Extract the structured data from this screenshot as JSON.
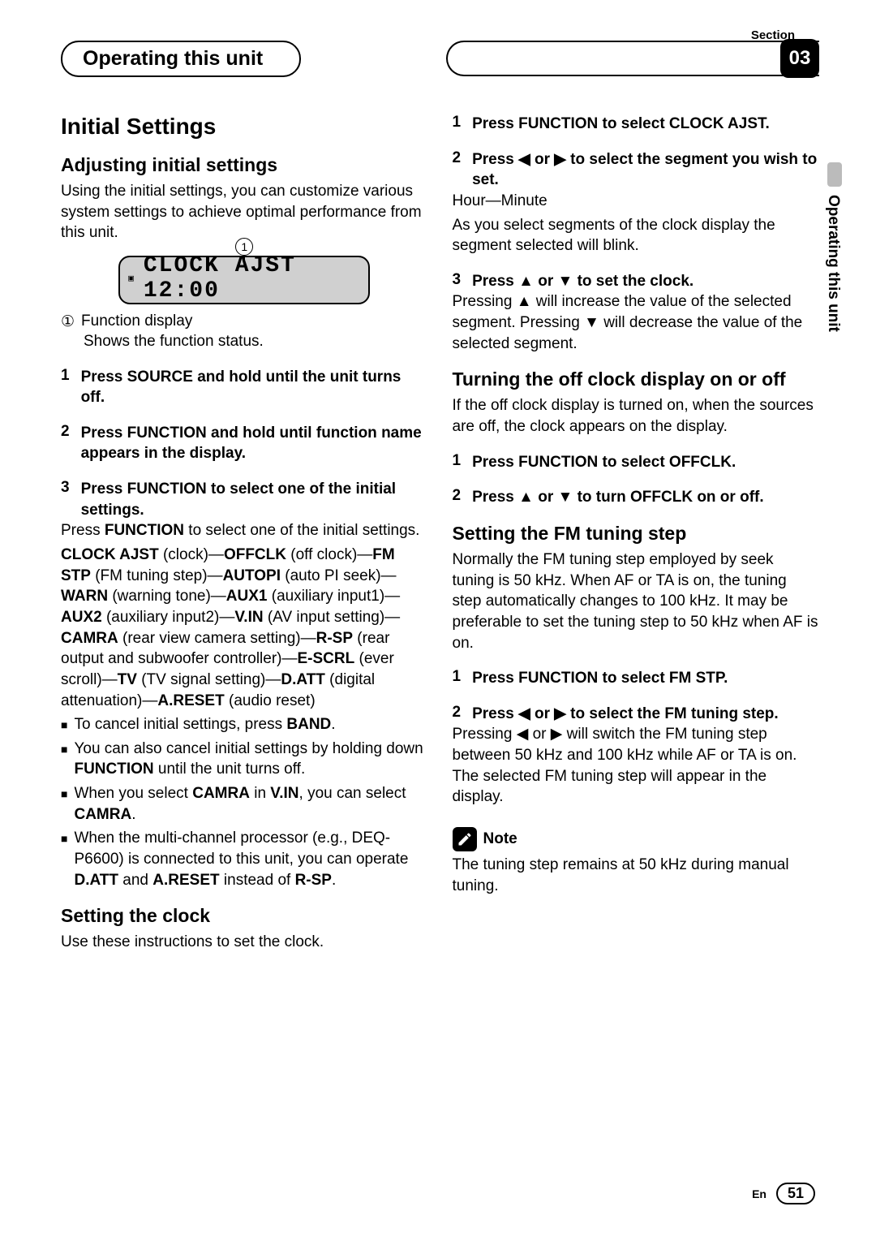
{
  "header": {
    "section_label": "Section",
    "title": "Operating this unit",
    "section_number": "03"
  },
  "side_tab": "Operating this unit",
  "left": {
    "h1": "Initial Settings",
    "h2a": "Adjusting initial settings",
    "intro": "Using the initial settings, you can customize various system settings to achieve optimal performance from this unit.",
    "lcd_text": "CLOCK  AJST  12:00",
    "callout_num": "1",
    "caption_num": "①",
    "caption_label": "Function display",
    "caption_body": "Shows the function status.",
    "steps": [
      {
        "n": "1",
        "bold": "Press SOURCE and hold until the unit turns off."
      },
      {
        "n": "2",
        "bold": "Press FUNCTION and hold until function name appears in the display."
      },
      {
        "n": "3",
        "bold": "Press FUNCTION to select one of the initial settings."
      }
    ],
    "step3_body1": "Press FUNCTION to select one of the initial settings.",
    "settings_chain_html": "CLOCK AJST (clock)—OFFCLK (off clock)—FM STP (FM tuning step)—AUTOPI (auto PI seek)—WARN (warning tone)—AUX1 (auxiliary input1)—AUX2 (auxiliary input2)—V.IN (AV input setting)—CAMRA (rear view camera setting)—R-SP (rear output and subwoofer controller)—E-SCRL (ever scroll)—TV (TV signal setting)—D.ATT (digital attenuation)—A.RESET (audio reset)",
    "bullets": [
      "To cancel initial settings, press BAND.",
      "You can also cancel initial settings by holding down FUNCTION until the unit turns off.",
      "When you select CAMRA in V.IN, you can select CAMRA.",
      "When the multi-channel processor (e.g., DEQ-P6600) is connected to this unit, you can operate D.ATT and A.RESET instead of R-SP."
    ],
    "h2b": "Setting the clock",
    "clock_intro": "Use these instructions to set the clock."
  },
  "right": {
    "clock_steps": [
      {
        "n": "1",
        "bold": "Press FUNCTION to select CLOCK AJST."
      },
      {
        "n": "2",
        "bold": "Press ◀ or ▶ to select the segment you wish to set."
      },
      {
        "n": "3",
        "bold": "Press ▲ or ▼ to set the clock."
      }
    ],
    "seg_body1": "Hour—Minute",
    "seg_body2": "As you select segments of the clock display the segment selected will blink.",
    "set_body": "Pressing ▲ will increase the value of the selected segment. Pressing ▼ will decrease the value of the selected segment.",
    "h2c": "Turning the off clock display on or off",
    "offclk_intro": "If the off clock display is turned on, when the sources are off, the clock appears on the display.",
    "offclk_steps": [
      {
        "n": "1",
        "bold": "Press FUNCTION to select OFFCLK."
      },
      {
        "n": "2",
        "bold": "Press ▲ or ▼ to turn OFFCLK on or off."
      }
    ],
    "h2d": "Setting the FM tuning step",
    "fm_intro": "Normally the FM tuning step employed by seek tuning is 50 kHz. When AF or TA is on, the tuning step automatically changes to 100 kHz. It may be preferable to set the tuning step to 50 kHz when AF is on.",
    "fm_steps": [
      {
        "n": "1",
        "bold": "Press FUNCTION to select FM STP."
      },
      {
        "n": "2",
        "bold": "Press ◀ or ▶ to select the FM tuning step."
      }
    ],
    "fm_body": "Pressing ◀ or ▶ will switch the FM tuning step between 50 kHz and 100 kHz while AF or TA is on. The selected FM tuning step will appear in the display.",
    "note_label": "Note",
    "note_body": "The tuning step remains at 50 kHz during manual tuning."
  },
  "footer": {
    "lang": "En",
    "page": "51"
  }
}
